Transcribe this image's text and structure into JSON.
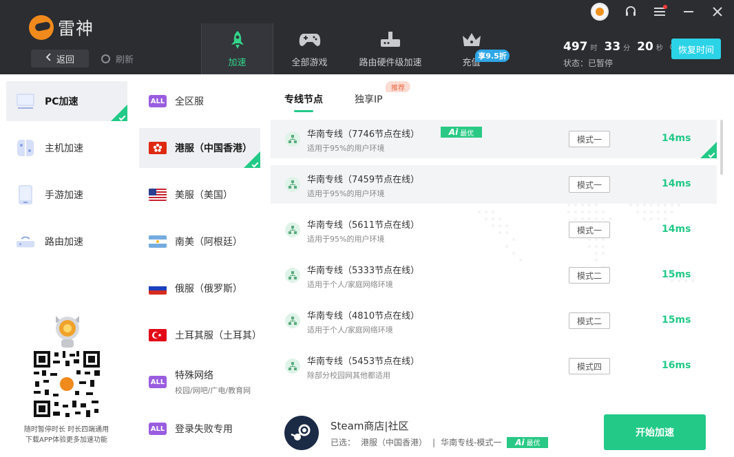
{
  "app": {
    "logo_text": "雷神",
    "back_label": "返回",
    "refresh_label": "刷新"
  },
  "nav": {
    "tabs": [
      {
        "label": "加速",
        "icon": "rocket-icon",
        "active": true
      },
      {
        "label": "全部游戏",
        "icon": "gamepad-icon"
      },
      {
        "label": "路由硬件级加速",
        "icon": "router-icon"
      },
      {
        "label": "充值",
        "icon": "crown-icon"
      }
    ],
    "discount_badge": "享9.5折"
  },
  "timer": {
    "hours": "497",
    "hours_unit": "时",
    "minutes": "33",
    "minutes_unit": "分",
    "seconds": "20",
    "seconds_unit": "秒"
  },
  "status_text": "状态：已暂停",
  "resume_label": "恢复时间",
  "sidebar": {
    "items": [
      {
        "label": "PC加速",
        "icon": "monitor-icon",
        "active": true
      },
      {
        "label": "主机加速",
        "icon": "console-icon"
      },
      {
        "label": "手游加速",
        "icon": "phone-icon"
      },
      {
        "label": "路由加速",
        "icon": "router-icon"
      }
    ],
    "promo_line1": "随时暂停时长 时长四端通用",
    "promo_line2": "下载APP体验更多加速功能"
  },
  "regions": [
    {
      "label": "全区服",
      "badge": "ALL"
    },
    {
      "label": "港服（中国香港）",
      "flag": "hk",
      "active": true
    },
    {
      "label": "美服（美国）",
      "flag": "us"
    },
    {
      "label": "南美（阿根廷）",
      "flag": "ar"
    },
    {
      "label": "俄服（俄罗斯）",
      "flag": "ru"
    },
    {
      "label": "土耳其服（土耳其）",
      "flag": "tr"
    },
    {
      "label": "特殊网络",
      "sub": "校园/网吧/广电/教育网",
      "badge": "ALL"
    },
    {
      "label": "登录失败专用",
      "badge": "ALL"
    }
  ],
  "tabs": [
    {
      "label": "专线节点",
      "active": true
    },
    {
      "label": "独享IP",
      "badge": "推荐"
    }
  ],
  "nodes": [
    {
      "title": "华南专线（7746节点在线）",
      "desc": "适用于95%的用户环境",
      "mode": "模式一",
      "ping": "14ms",
      "ai_badge": "Ai",
      "ai_label": "最优",
      "selected": true
    },
    {
      "title": "华南专线（7459节点在线）",
      "desc": "适用于95%的用户环境",
      "mode": "模式一",
      "ping": "14ms"
    },
    {
      "title": "华南专线（5611节点在线）",
      "desc": "适用于95%的用户环境",
      "mode": "模式一",
      "ping": "14ms"
    },
    {
      "title": "华南专线（5333节点在线）",
      "desc": "适用于个人/家庭网络环境",
      "mode": "模式二",
      "ping": "15ms"
    },
    {
      "title": "华南专线（4810节点在线）",
      "desc": "适用于个人/家庭网络环境",
      "mode": "模式二",
      "ping": "15ms"
    },
    {
      "title": "华南专线（5453节点在线）",
      "desc": "除部分校园网其他都适用",
      "mode": "模式四",
      "ping": "16ms"
    }
  ],
  "bottom": {
    "game_name": "Steam商店|社区",
    "selected_prefix": "已选：",
    "selected_region": "港服（中国香港）",
    "separator": "|",
    "selected_node": "华南专线-模式一",
    "ai_badge": "Ai",
    "ai_label": "最优",
    "start_label": "开始加速"
  }
}
